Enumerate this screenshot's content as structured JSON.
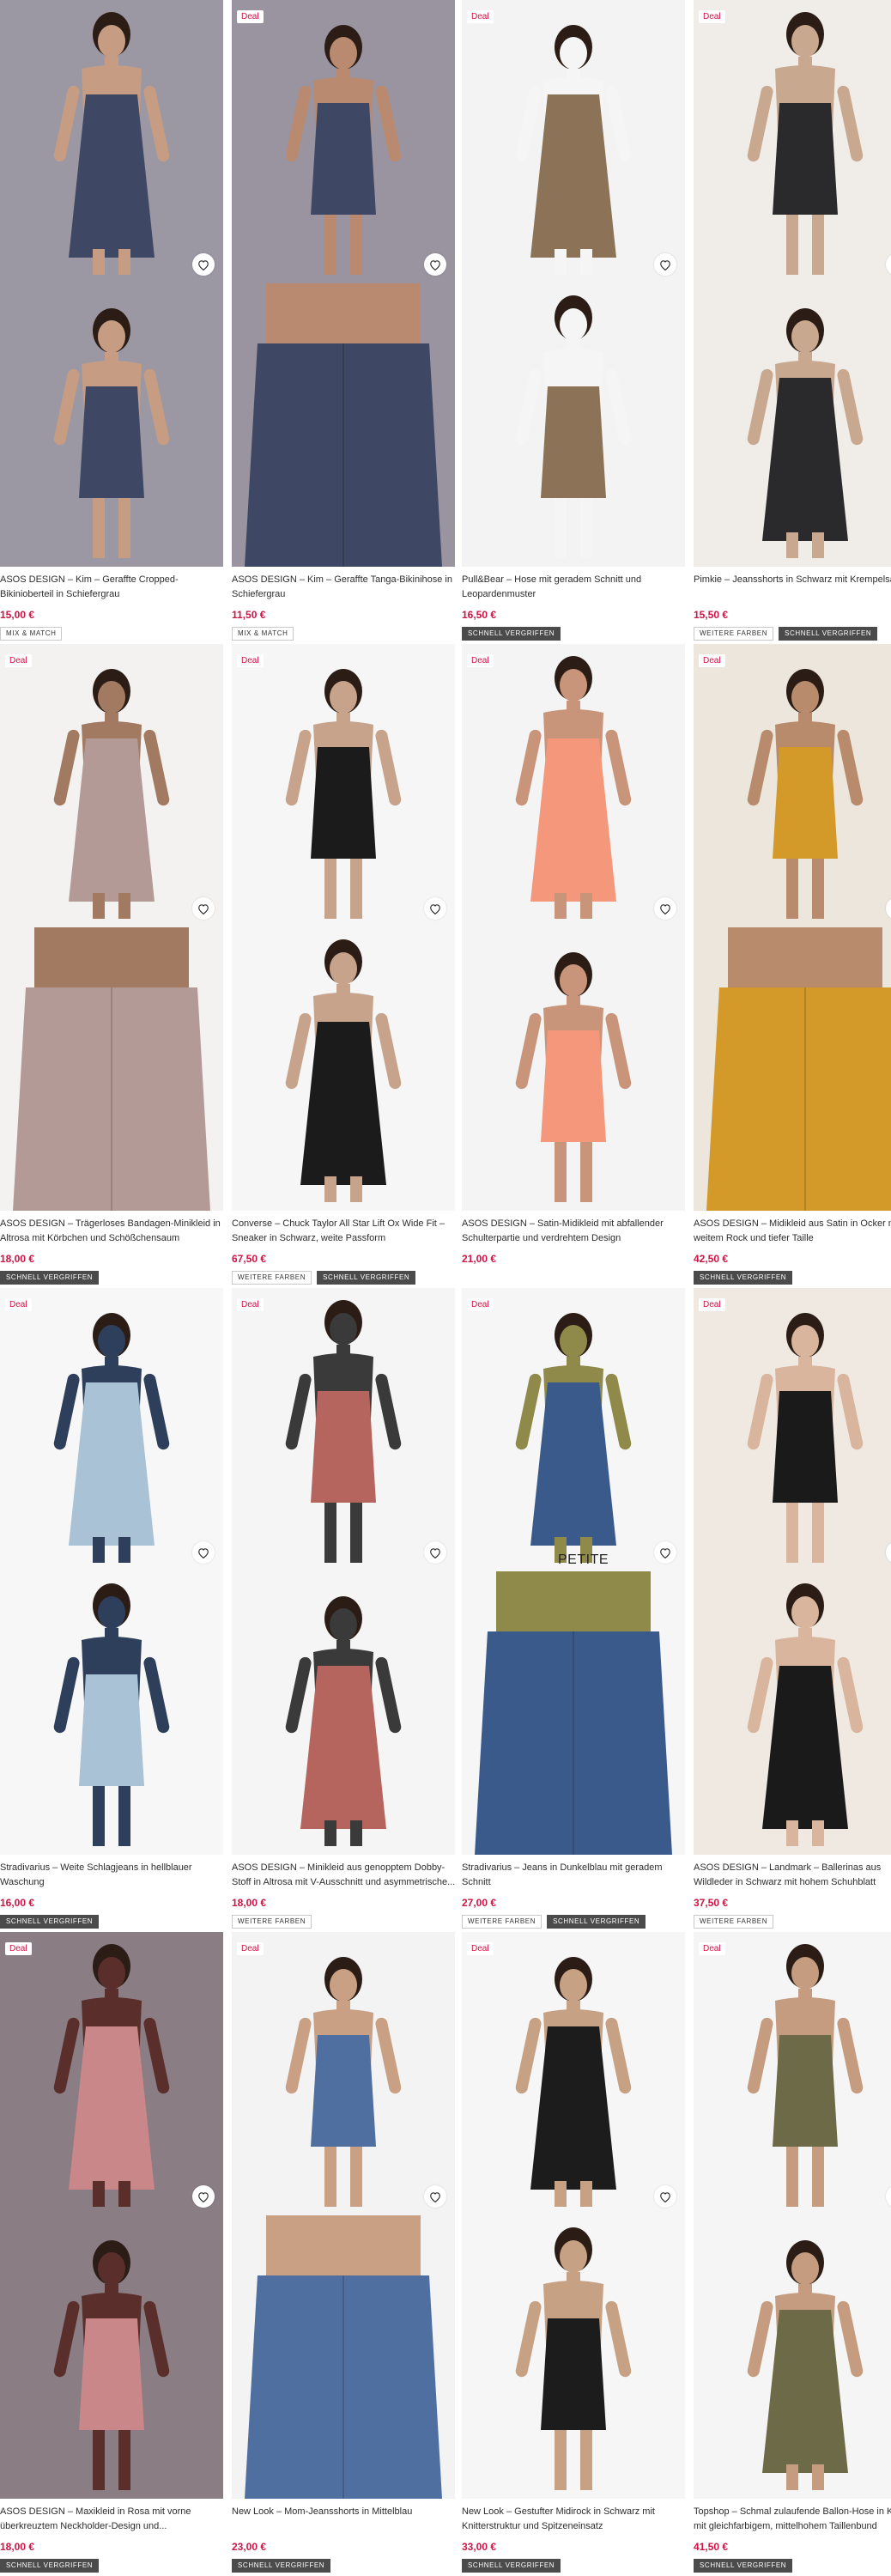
{
  "products": [
    {
      "title": "ASOS DESIGN – Kim – Geraffte Cropped-Bikinioberteil in Schiefergrau",
      "price": "15,00 €",
      "deal": "",
      "badges": [
        "MIX & MATCH"
      ],
      "colors": [
        "#9b98a3",
        "#3e4763",
        "#c69c83"
      ]
    },
    {
      "title": "ASOS DESIGN – Kim – Geraffte Tanga-Bikinihose in Schiefergrau",
      "price": "11,50 €",
      "deal": "Deal",
      "badges": [
        "MIX & MATCH"
      ],
      "colors": [
        "#9994a0",
        "#3e4763",
        "#b98a6f"
      ]
    },
    {
      "title": "Pull&Bear – Hose mit geradem Schnitt und Leopardenmuster",
      "price": "16,50 €",
      "deal": "Deal",
      "badges": [
        "SCHNELL VERGRIFFEN"
      ],
      "colors": [
        "#f3f3f3",
        "#8c7358",
        "#f5f5f5"
      ]
    },
    {
      "title": "Pimkie – Jeansshorts in Schwarz mit Krempelsaum",
      "price": "15,50 €",
      "deal": "Deal",
      "badges": [
        "WEITERE FARBEN",
        "SCHNELL VERGRIFFEN"
      ],
      "colors": [
        "#f0ede9",
        "#2a2a2c",
        "#c9a890"
      ]
    },
    {
      "title": "ASOS DESIGN – Trägerloses Bandagen-Minikleid in Altrosa mit Körbchen und Schößchensaum",
      "price": "18,00 €",
      "deal": "Deal",
      "badges": [
        "SCHNELL VERGRIFFEN"
      ],
      "colors": [
        "#f4f2f0",
        "#b49a96",
        "#a27a61"
      ]
    },
    {
      "title": "Converse – Chuck Taylor All Star Lift Ox Wide Fit – Sneaker in Schwarz, weite Passform",
      "price": "67,50 €",
      "deal": "Deal",
      "badges": [
        "WEITERE FARBEN",
        "SCHNELL VERGRIFFEN"
      ],
      "colors": [
        "#f6f6f6",
        "#1b1b1b",
        "#c7a38b"
      ]
    },
    {
      "title": "ASOS DESIGN – Satin-Midikleid mit abfallender Schulterpartie und verdrehtem Design",
      "price": "21,00 €",
      "deal": "Deal",
      "badges": [],
      "colors": [
        "#f4f4f4",
        "#f4977a",
        "#c9957a"
      ]
    },
    {
      "title": "ASOS DESIGN – Midikleid aus Satin in Ocker mit weitem Rock und tiefer Taille",
      "price": "42,50 €",
      "deal": "Deal",
      "badges": [
        "SCHNELL VERGRIFFEN"
      ],
      "colors": [
        "#ece6dc",
        "#d39a2a",
        "#b88b6d"
      ]
    },
    {
      "title": "Stradivarius – Weite Schlagjeans in hellblauer Waschung",
      "price": "16,00 €",
      "deal": "Deal",
      "badges": [
        "SCHNELL VERGRIFFEN"
      ],
      "colors": [
        "#f7f7f7",
        "#a9c2d6",
        "#2e3f5b"
      ]
    },
    {
      "title": "ASOS DESIGN – Minikleid aus genopptem Dobby-Stoff in Altrosa mit V-Ausschnitt und asymmetrische...",
      "price": "18,00 €",
      "deal": "Deal",
      "badges": [
        "WEITERE FARBEN"
      ],
      "colors": [
        "#f5f5f5",
        "#b5655e",
        "#3a3a3a"
      ]
    },
    {
      "title": "Stradivarius – Jeans in Dunkelblau mit geradem Schnitt",
      "price": "27,00 €",
      "deal": "Deal",
      "badges": [
        "WEITERE FARBEN",
        "SCHNELL VERGRIFFEN"
      ],
      "colors": [
        "#f6f6f6",
        "#3b5a8c",
        "#8f8a4a"
      ]
    },
    {
      "title": "ASOS DESIGN – Landmark – Ballerinas aus Wildleder in Schwarz mit hohem Schuhblatt",
      "price": "37,50 €",
      "deal": "Deal",
      "badges": [
        "WEITERE FARBEN"
      ],
      "colors": [
        "#efe9e2",
        "#1a1a1a",
        "#d8b59c"
      ]
    },
    {
      "title": "ASOS DESIGN – Maxikleid in Rosa mit vorne überkreuztem Neckholder-Design und...",
      "price": "18,00 €",
      "deal": "Deal",
      "badges": [
        "SCHNELL VERGRIFFEN"
      ],
      "colors": [
        "#8a7d84",
        "#c9878a",
        "#5a2f2b"
      ]
    },
    {
      "title": "New Look – Mom-Jeansshorts in Mittelblau",
      "price": "23,00 €",
      "deal": "Deal",
      "badges": [
        "SCHNELL VERGRIFFEN"
      ],
      "colors": [
        "#f3f3f3",
        "#4f6fa1",
        "#c9a083"
      ]
    },
    {
      "title": "New Look – Gestufter Midirock in Schwarz mit Knitterstruktur und Spitzeneinsatz",
      "price": "33,00 €",
      "deal": "Deal",
      "badges": [
        "SCHNELL VERGRIFFEN"
      ],
      "colors": [
        "#f6f6f6",
        "#1c1c1c",
        "#c6a184"
      ]
    },
    {
      "title": "Topshop – Schmal zulaufende Ballon-Hose in Khaki mit gleichfarbigem, mittelhohem Taillenbund",
      "price": "41,50 €",
      "deal": "Deal",
      "badges": [
        "SCHNELL VERGRIFFEN"
      ],
      "colors": [
        "#f5f5f5",
        "#6d6a48",
        "#c59c7f"
      ]
    }
  ],
  "petite_label": "PETITE",
  "icons": {
    "wishlist": "heart-icon"
  },
  "accent_color": "#d01345"
}
